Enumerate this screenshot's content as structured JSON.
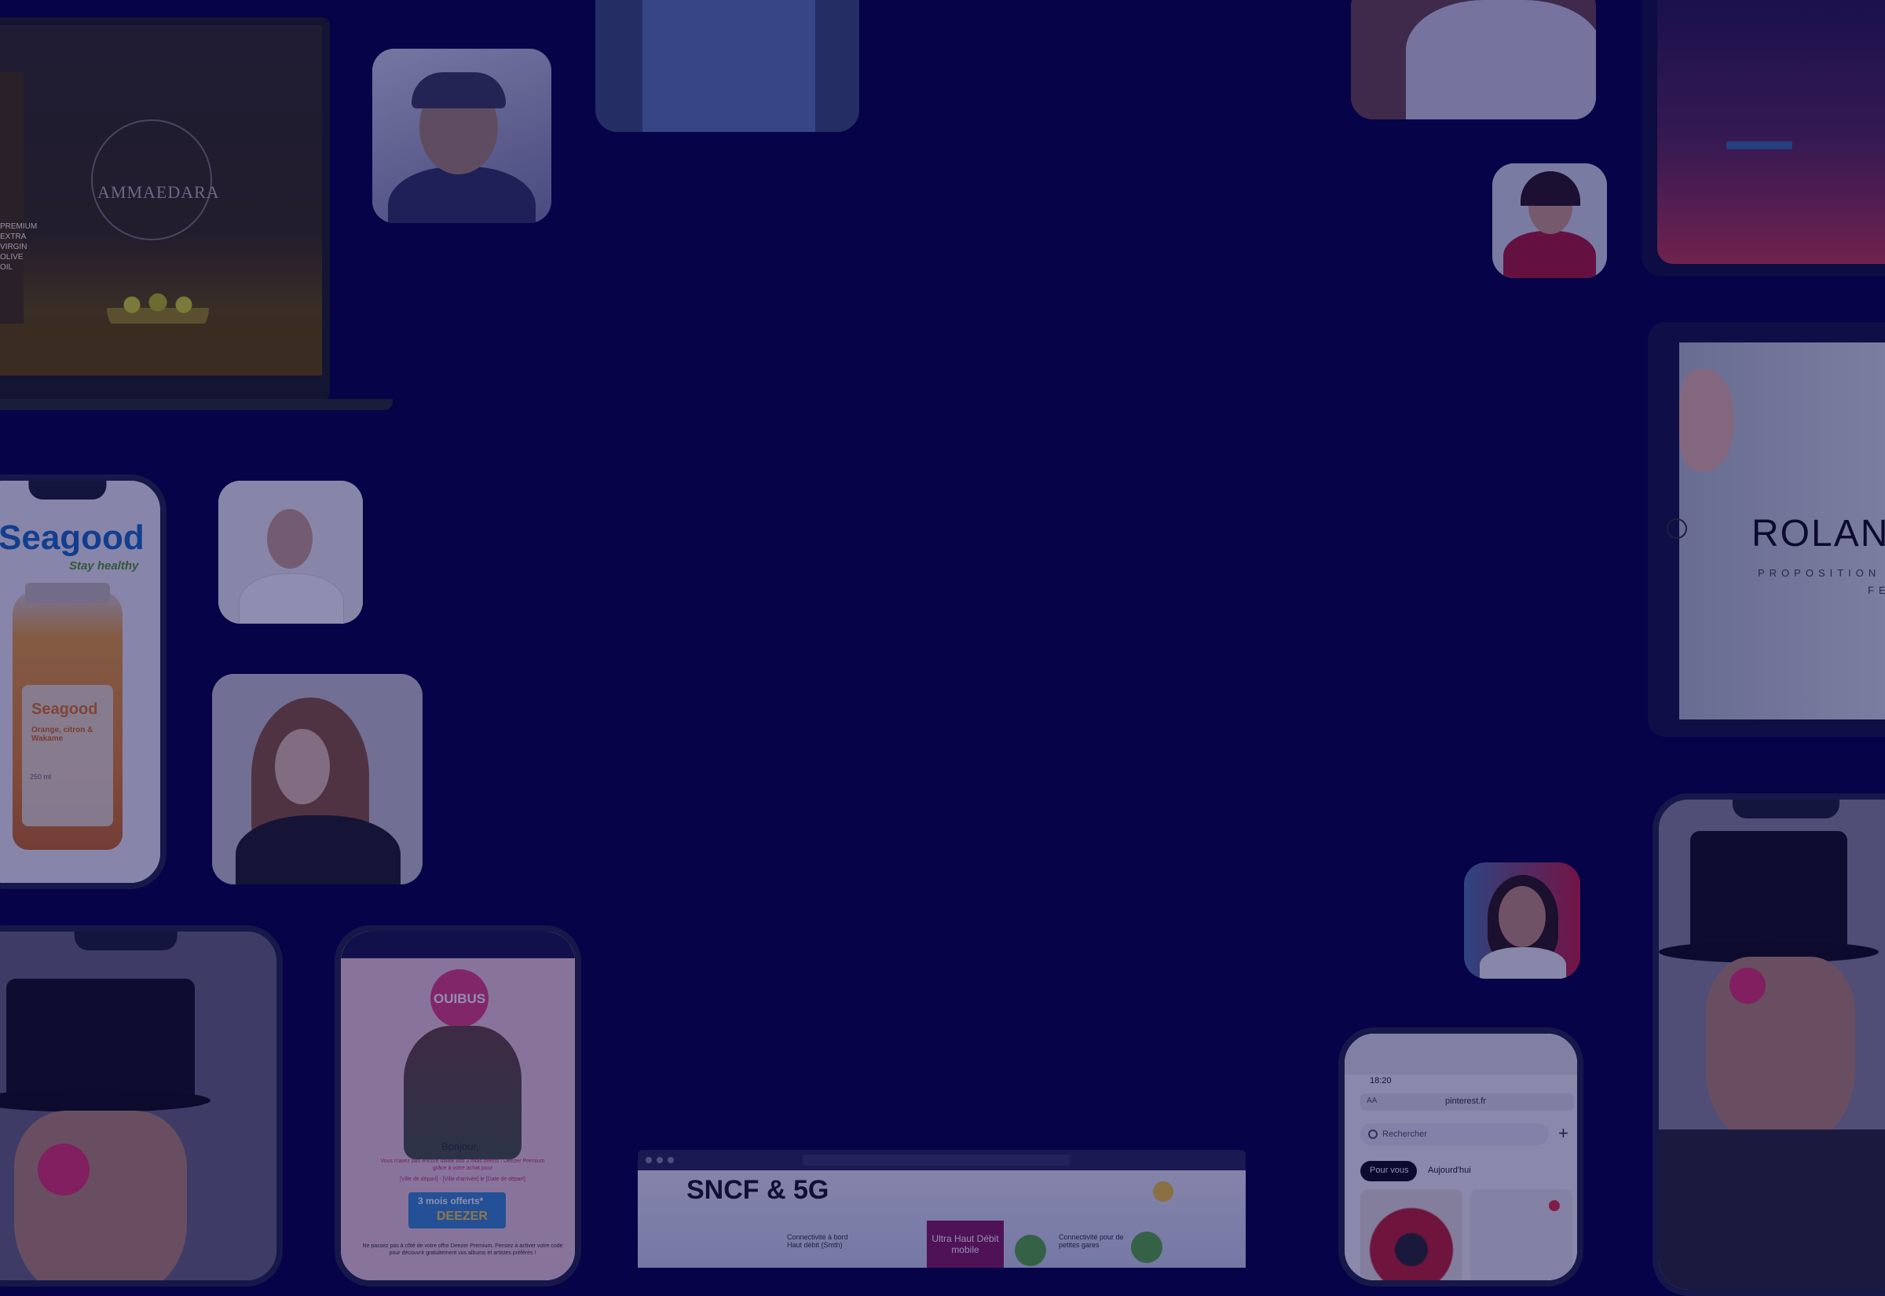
{
  "showcase": {
    "laptop": {
      "brand": "AMMAEDARA",
      "side_text": "PREMIUM EXTRA VIRGIN OLIVE OIL"
    },
    "seagood": {
      "logo": "Seagood",
      "tagline": "Stay healthy",
      "label_brand": "Seagood",
      "label_text": "Orange, citron & Wakame",
      "volume": "250 ml"
    },
    "ouibus": {
      "logo": "OUIBUS",
      "greeting": "Bonjour,",
      "body": "Vous n'avez pas encore utilisé vos 3 mois offerts ! Deezer Premium grâce à votre achat pour",
      "trip": "[Ville de départ] - [Ville d'arrivée] le [Date de départ]",
      "offer": "3 mois offerts*",
      "partner": "DEEZER",
      "footer": "Ne passez pas à côté de votre offre Deezer Premium. Pensez à activer votre code pour découvrir gratuitement vos albums et artistes préférés !"
    },
    "sncf": {
      "title": "SNCF & 5G",
      "left_caption": "Connectivité à bord Haut débit (Smth)",
      "center_badge": "Ultra Haut Débit mobile",
      "right_caption": "Connectivité pour de petites gares"
    },
    "pinterest": {
      "time": "18:20",
      "reader": "AA",
      "url": "pinterest.fr",
      "search_placeholder": "Rechercher",
      "add": "+",
      "tab_for_you": "Pour vous",
      "tab_today": "Aujourd'hui"
    },
    "tablet": {
      "brand": "ROLAN",
      "subtitle": "PROPOSITION",
      "date": "FEB"
    },
    "colors": {
      "background": "#060348",
      "accent_pink": "#e4447f",
      "seagood_green": "#5a9d2a",
      "seagood_blue": "#1a6ec2"
    }
  }
}
